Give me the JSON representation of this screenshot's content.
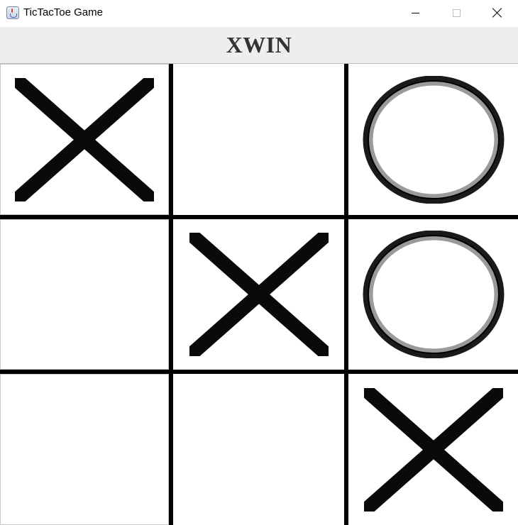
{
  "window": {
    "title": "TicTacToe Game",
    "icon": "java-cup-icon"
  },
  "status": {
    "text": "XWIN"
  },
  "board": {
    "cells": [
      "X",
      "",
      "O",
      "",
      "X",
      "O",
      "",
      "",
      "X"
    ]
  }
}
